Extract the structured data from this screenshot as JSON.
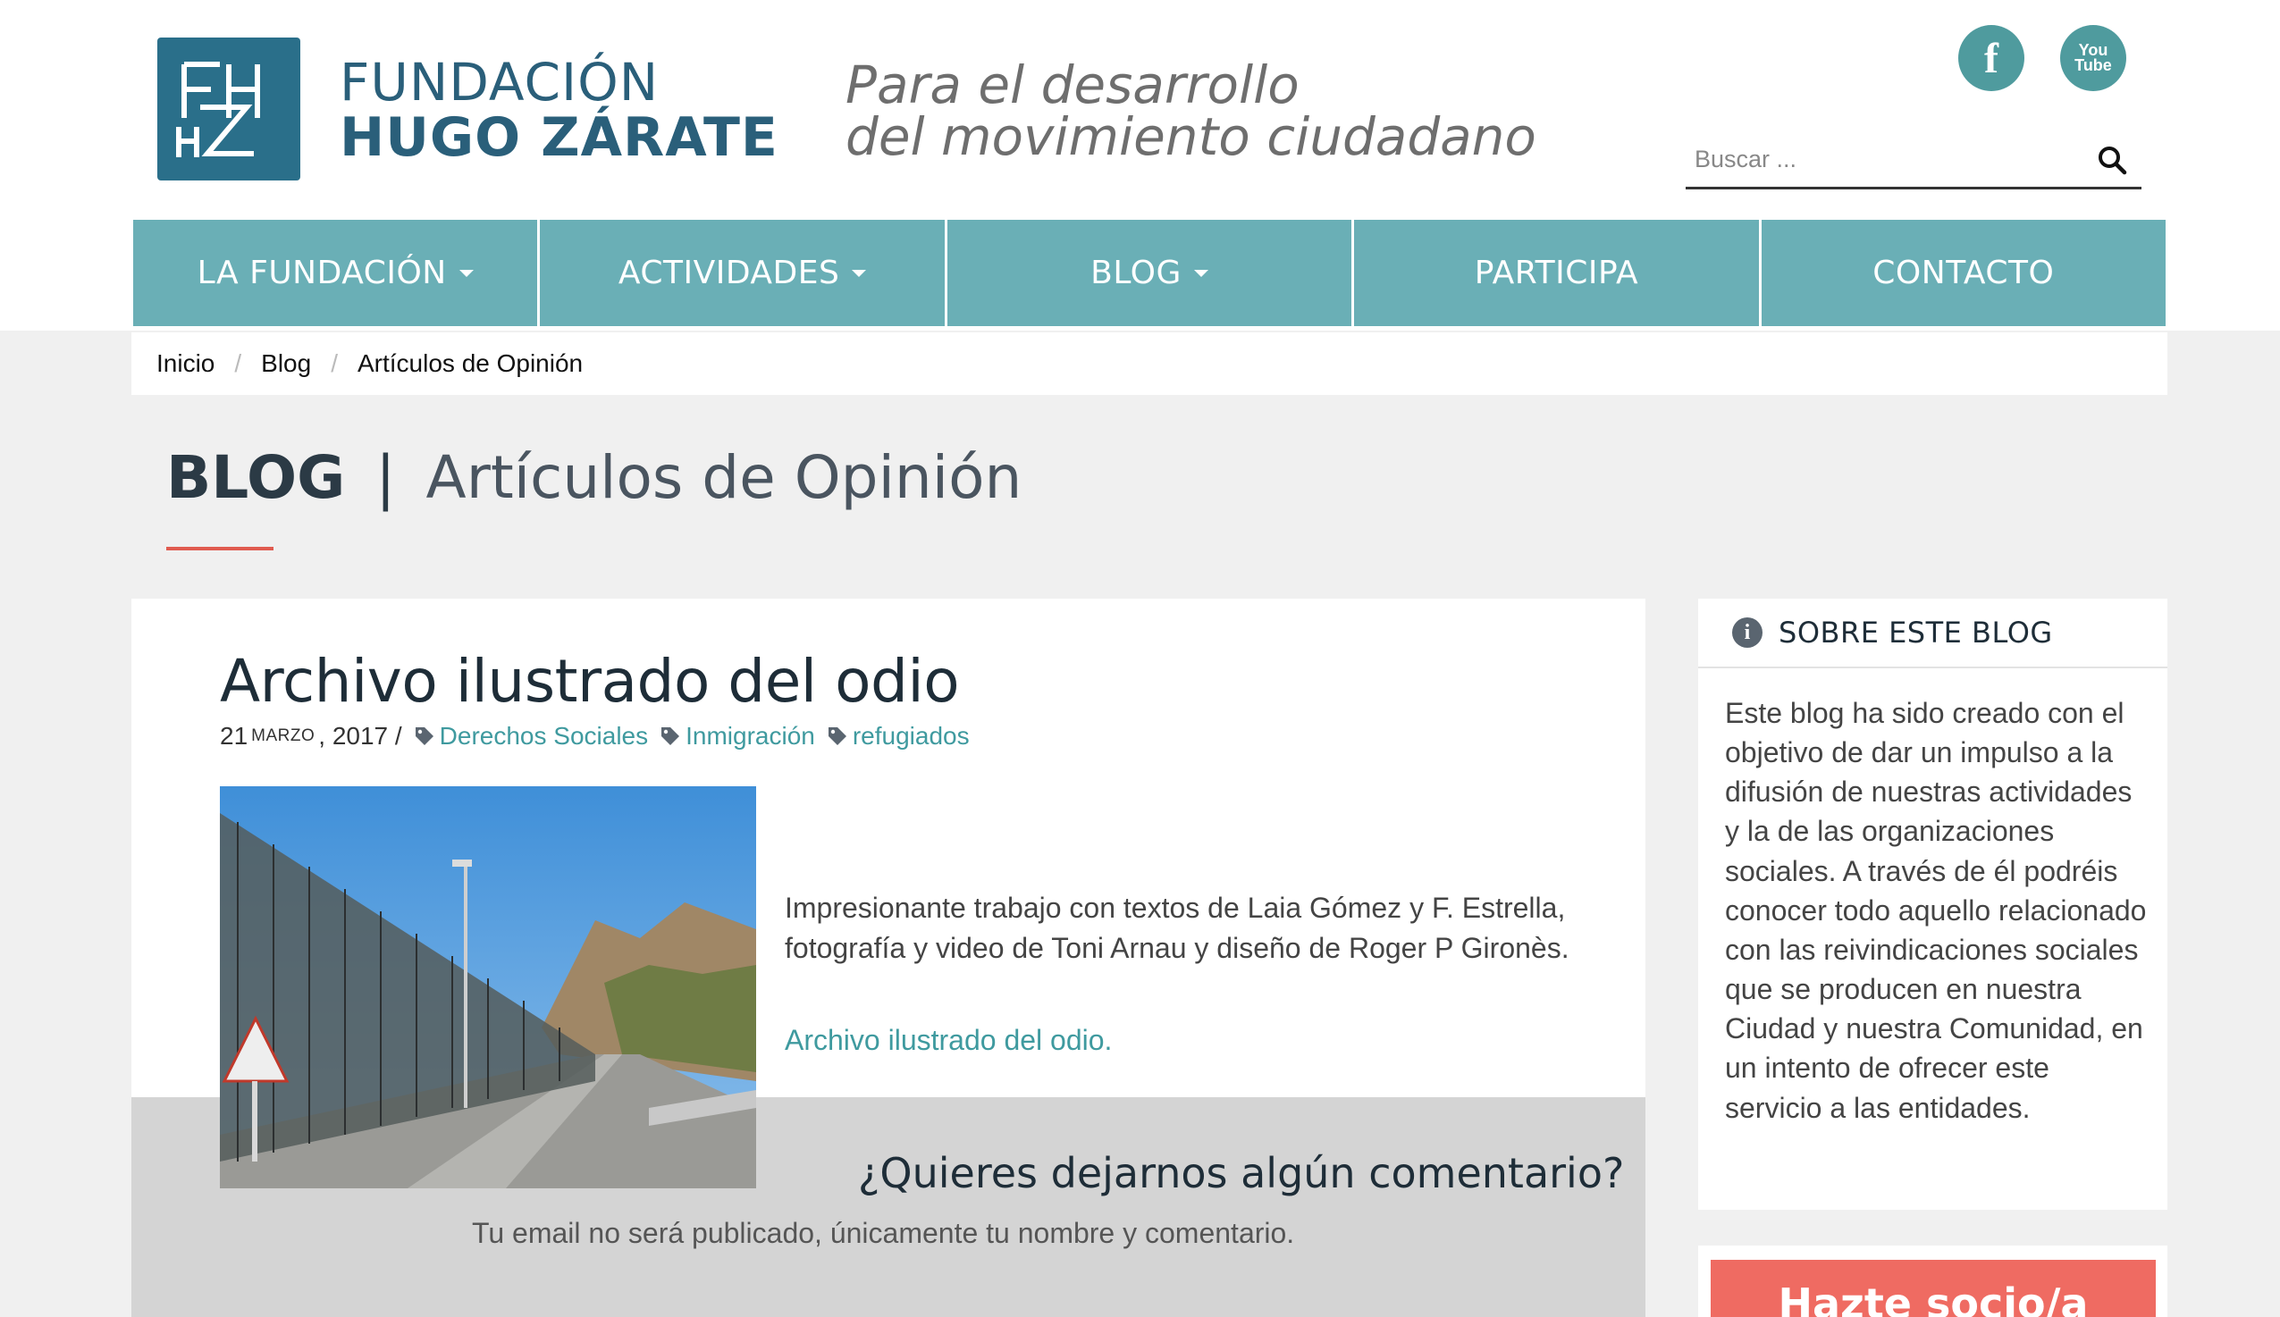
{
  "header": {
    "logo_line1": "FUNDACIÓN",
    "logo_line2": "HUGO ZÁRATE",
    "tagline_line1": "Para el desarrollo",
    "tagline_line2": "del movimiento ciudadano",
    "social": [
      {
        "icon": "facebook-icon",
        "label": "f"
      },
      {
        "icon": "youtube-icon",
        "label_top": "You",
        "label_bottom": "Tube"
      }
    ],
    "search": {
      "placeholder": "Buscar ..."
    }
  },
  "nav": {
    "items": [
      {
        "label": "LA FUNDACIÓN",
        "dropdown": true
      },
      {
        "label": "ACTIVIDADES",
        "dropdown": true
      },
      {
        "label": "BLOG",
        "dropdown": true
      },
      {
        "label": "PARTICIPA",
        "dropdown": false
      },
      {
        "label": "CONTACTO",
        "dropdown": false
      }
    ]
  },
  "breadcrumb": {
    "items": [
      "Inicio",
      "Blog",
      "Artículos de Opinión"
    ],
    "separator": "/"
  },
  "page_title": {
    "main": "BLOG",
    "separator": "|",
    "sub": "Artículos de Opinión"
  },
  "article": {
    "title": "Archivo ilustrado del odio",
    "date_day": "21",
    "date_month": "marzo",
    "date_year": ", 2017 /",
    "tags": [
      "Derechos Sociales",
      "Inmigración",
      "refugiados"
    ],
    "body": "Impresionante trabajo con textos de Laia Gómez y F. Estrella, fotografía y video de Toni Arnau y diseño de Roger P Gironès.",
    "link": "Archivo ilustrado del odio."
  },
  "comments": {
    "title": "¿Quieres dejarnos algún comentario?",
    "subtitle": "Tu email no será publicado, únicamente tu nombre y comentario."
  },
  "sidebar": {
    "about_title": "SOBRE ESTE BLOG",
    "about_text": "Este blog ha sido creado con el objetivo de dar un impulso a la difusión de nuestras actividades y la de las organizaciones sociales. A través de él podréis conocer todo aquello relacionado con las reivindicaciones sociales que se producen en nuestra Ciudad y nuestra Comunidad, en un intento de ofrecer este servicio a las entidades.",
    "cta_label": "Hazte socio/a"
  },
  "colors": {
    "nav": "#6aafb6",
    "accent_link": "#3f9a9f",
    "logo": "#2a6f8a",
    "title_underline": "#e05b4f",
    "cta": "#ef6b62"
  }
}
